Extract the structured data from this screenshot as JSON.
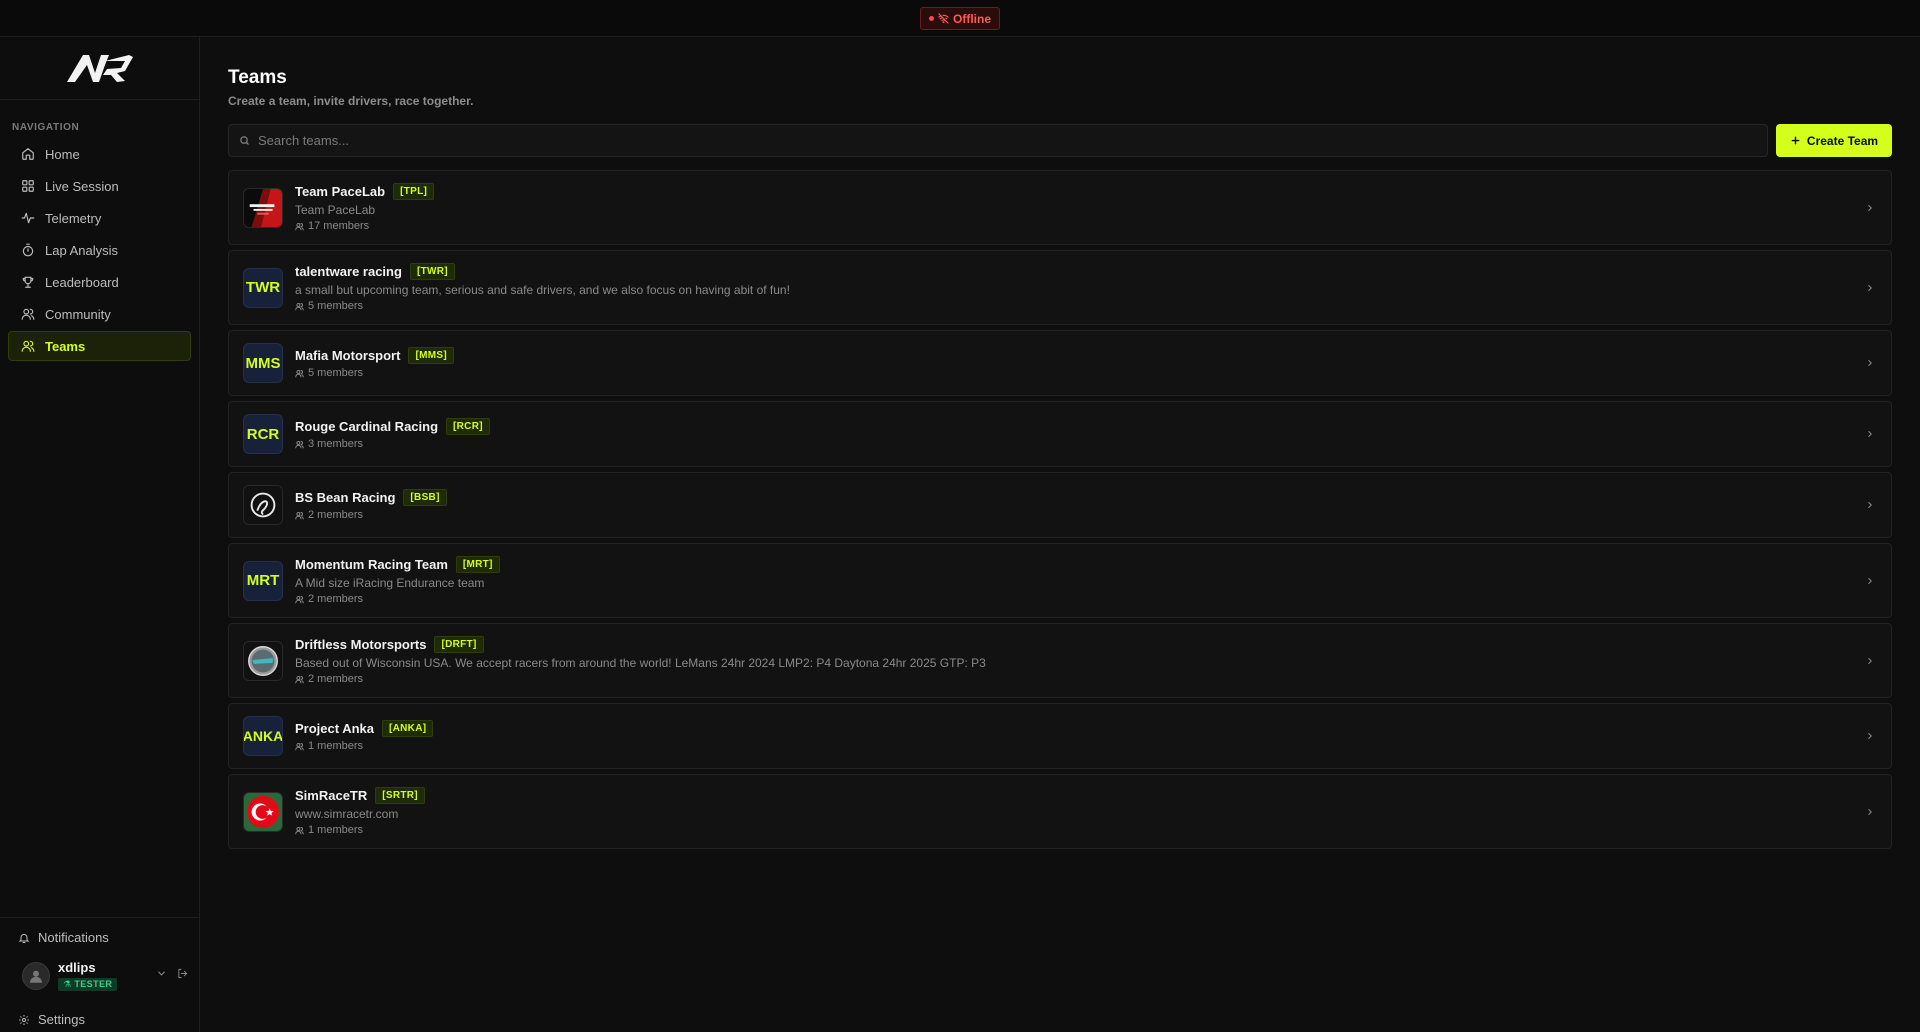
{
  "status": {
    "label": "Offline",
    "color": "#ff4747"
  },
  "sidebar": {
    "nav_title": "NAVIGATION",
    "items": [
      {
        "label": "Home",
        "icon": "home-icon"
      },
      {
        "label": "Live Session",
        "icon": "grid-icon"
      },
      {
        "label": "Telemetry",
        "icon": "activity-icon"
      },
      {
        "label": "Lap Analysis",
        "icon": "timer-icon"
      },
      {
        "label": "Leaderboard",
        "icon": "trophy-icon"
      },
      {
        "label": "Community",
        "icon": "users-icon"
      },
      {
        "label": "Teams",
        "icon": "users-icon",
        "active": true
      }
    ],
    "notifications_label": "Notifications",
    "user": {
      "name": "xdlips",
      "badge": "TESTER"
    },
    "settings_label": "Settings"
  },
  "page": {
    "title": "Teams",
    "subtitle": "Create a team, invite drivers, race together.",
    "search_placeholder": "Search teams...",
    "create_label": "Create Team"
  },
  "teams": [
    {
      "name": "Team PaceLab",
      "tag": "[TPL]",
      "desc": "Team PaceLab",
      "members": "17 members",
      "logo_type": "pacelab"
    },
    {
      "name": "talentware racing",
      "tag": "[TWR]",
      "desc": "a small but upcoming team, serious and safe drivers, and we also focus on having abit of fun!",
      "members": "5 members",
      "logo_text": "TWR"
    },
    {
      "name": "Mafia Motorsport",
      "tag": "[MMS]",
      "desc": "",
      "members": "5 members",
      "logo_text": "MMS"
    },
    {
      "name": "Rouge Cardinal Racing",
      "tag": "[RCR]",
      "desc": "",
      "members": "3 members",
      "logo_text": "RCR"
    },
    {
      "name": "BS Bean Racing",
      "tag": "[BSB]",
      "desc": "",
      "members": "2 members",
      "logo_type": "bean"
    },
    {
      "name": "Momentum Racing Team",
      "tag": "[MRT]",
      "desc": "A Mid size iRacing Endurance team",
      "members": "2 members",
      "logo_text": "MRT"
    },
    {
      "name": "Driftless Motorsports",
      "tag": "[DRFT]",
      "desc": "Based out of Wisconsin USA. We accept racers from around the world! LeMans 24hr 2024 LMP2: P4 Daytona 24hr 2025 GTP: P3",
      "members": "2 members",
      "logo_type": "driftless"
    },
    {
      "name": "Project Anka",
      "tag": "[ANKA]",
      "desc": "",
      "members": "1 members",
      "logo_text": "ANKA"
    },
    {
      "name": "SimRaceTR",
      "tag": "[SRTR]",
      "desc": "www.simracetr.com",
      "members": "1 members",
      "logo_type": "turkey"
    }
  ],
  "colors": {
    "accent": "#d4ff1a",
    "background": "#0e0e0e",
    "card": "#121212"
  }
}
